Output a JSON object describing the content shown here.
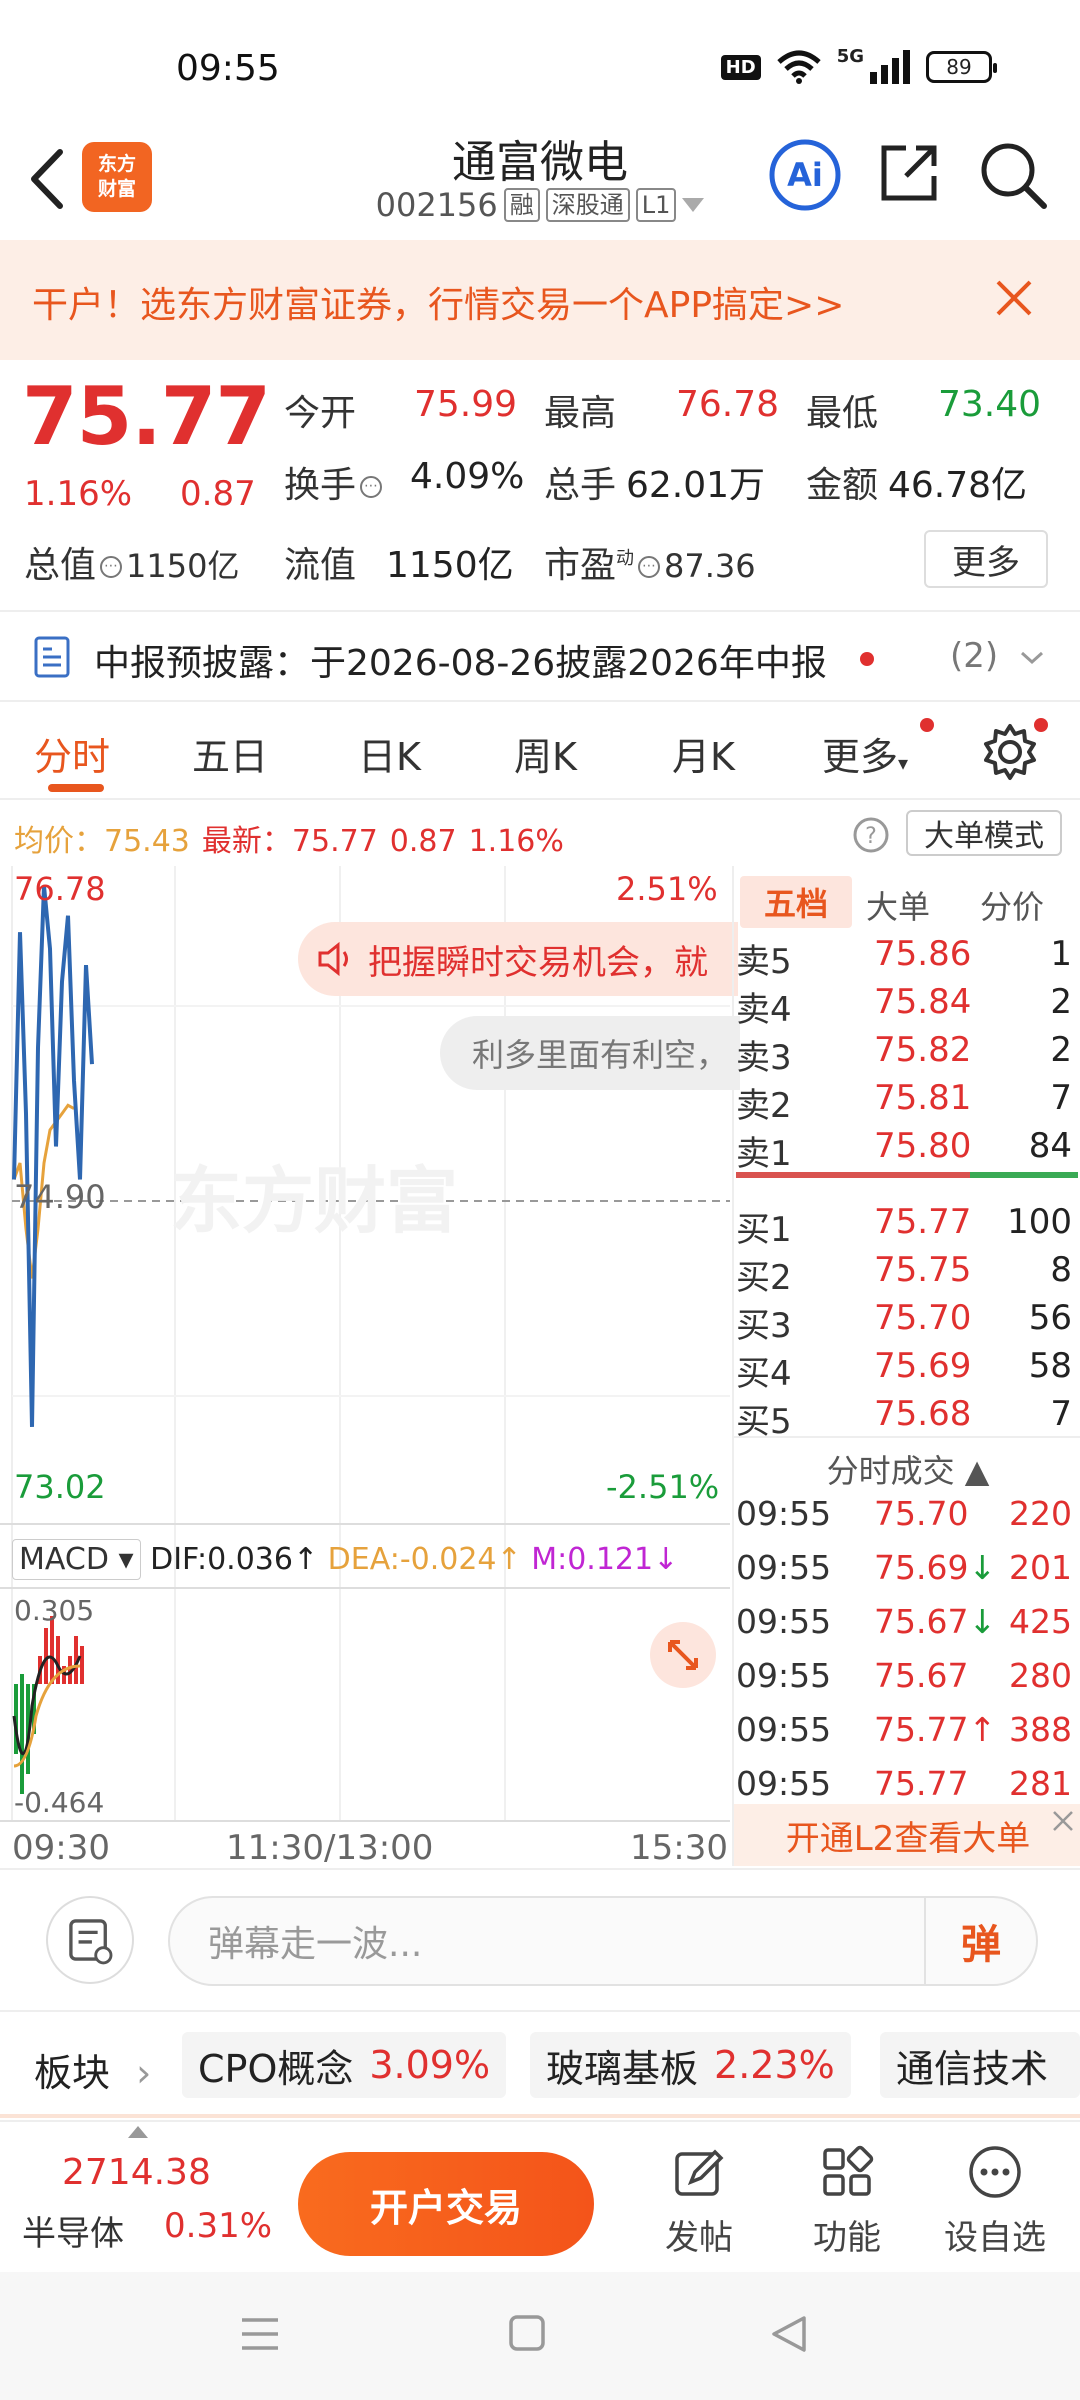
{
  "status_bar": {
    "time": "09:55",
    "network": "5G",
    "hd": "HD",
    "battery": "89"
  },
  "header": {
    "logo_line1": "东方",
    "logo_line2": "财富",
    "stock_name": "通富微电",
    "stock_code": "002156",
    "tag_margin": "融",
    "tag_connect": "深股通",
    "tag_level": "L1",
    "ai_label": "Ai"
  },
  "promo": {
    "text": "干户！选东方财富证券，行情交易一个APP搞定>>"
  },
  "quote": {
    "last_price": "75.77",
    "change_pct": "1.16%",
    "change_amt": "0.87",
    "open_label": "今开",
    "open_value": "75.99",
    "high_label": "最高",
    "high_value": "76.78",
    "low_label": "最低",
    "low_value": "73.40",
    "turnover_label": "换手",
    "turnover_value": "4.09%",
    "volume_label": "总手",
    "volume_value": "62.01万",
    "amount_label": "金额",
    "amount_value": "46.78亿",
    "mktcap_label": "总值",
    "mktcap_value": "1150亿",
    "float_label": "流值",
    "float_value": "1150亿",
    "pe_label": "市盈",
    "pe_sup": "动",
    "pe_value": "87.36",
    "more_label": "更多"
  },
  "notice": {
    "text": "中报预披露：于2026-08-26披露2026年中报",
    "count": "(2)"
  },
  "period_tabs": [
    "分时",
    "五日",
    "日K",
    "周K",
    "月K",
    "更多"
  ],
  "avg_row": {
    "avg_label": "均价：",
    "avg_value": "75.43",
    "latest_label": "最新：",
    "latest_value": "75.77",
    "latest_change": "0.87",
    "latest_pct": "1.16%",
    "mode_btn": "大单模式"
  },
  "chart": {
    "y_top": "76.78",
    "y_top_pct": "2.51%",
    "y_mid": "74.90",
    "y_bottom": "73.02",
    "y_bottom_pct": "-2.51%",
    "watermark": "东方财富",
    "tip_text": "把握瞬时交易机会，就",
    "tip2_text": "利多里面有利空，",
    "macd_select": "MACD",
    "dif": "DIF:0.036",
    "dea": "DEA:-0.024",
    "m": "M:0.121",
    "macd_top": "0.305",
    "macd_bottom": "-0.464",
    "time_start": "09:30",
    "time_mid": "11:30/13:00",
    "time_end": "15:30",
    "price_line": [
      75.0,
      76.5,
      75.4,
      73.5,
      75.8,
      76.78,
      76.4,
      75.2,
      76.2,
      76.6,
      75.6,
      75.0,
      76.3,
      75.7
    ],
    "avg_line": [
      75.0,
      75.1,
      74.7,
      74.4,
      74.7,
      75.1,
      75.3,
      75.35,
      75.4,
      75.45,
      75.43
    ]
  },
  "order_book": {
    "tabs": [
      "五档",
      "大单",
      "分价"
    ],
    "asks": [
      {
        "label": "卖5",
        "price": "75.86",
        "vol": "1"
      },
      {
        "label": "卖4",
        "price": "75.84",
        "vol": "2"
      },
      {
        "label": "卖3",
        "price": "75.82",
        "vol": "2"
      },
      {
        "label": "卖2",
        "price": "75.81",
        "vol": "7"
      },
      {
        "label": "卖1",
        "price": "75.80",
        "vol": "84"
      }
    ],
    "bids": [
      {
        "label": "买1",
        "price": "75.77",
        "vol": "100"
      },
      {
        "label": "买2",
        "price": "75.75",
        "vol": "8"
      },
      {
        "label": "买3",
        "price": "75.70",
        "vol": "56"
      },
      {
        "label": "买4",
        "price": "75.69",
        "vol": "58"
      },
      {
        "label": "买5",
        "price": "75.68",
        "vol": "7"
      }
    ],
    "ticks_title": "分时成交",
    "ticks": [
      {
        "time": "09:55",
        "price": "75.70",
        "arrow": "",
        "vol": "220"
      },
      {
        "time": "09:55",
        "price": "75.69",
        "arrow": "↓",
        "vol": "201"
      },
      {
        "time": "09:55",
        "price": "75.67",
        "arrow": "↓",
        "vol": "425"
      },
      {
        "time": "09:55",
        "price": "75.67",
        "arrow": "",
        "vol": "280"
      },
      {
        "time": "09:55",
        "price": "75.77",
        "arrow": "↑",
        "vol": "388"
      },
      {
        "time": "09:55",
        "price": "75.77",
        "arrow": "",
        "vol": "281"
      }
    ],
    "l2_btn": "开通L2查看大单"
  },
  "comment_bar": {
    "placeholder": "弹幕走一波...",
    "send_label": "弹"
  },
  "sectors": {
    "label": "板块",
    "chips": [
      {
        "name": "CPO概念",
        "pct": "3.09%"
      },
      {
        "name": "玻璃基板",
        "pct": "2.23%"
      },
      {
        "name": "通信技术",
        "pct": ""
      }
    ]
  },
  "bottom_toolbar": {
    "index_value": "2714.38",
    "index_name": "半导体",
    "index_pct": "0.31%",
    "open_account": "开户交易",
    "post": "发帖",
    "function": "功能",
    "watchlist": "设自选"
  },
  "colors": {
    "up": "#e0302f",
    "down": "#1a9c3a",
    "accent": "#e8561e",
    "price_line": "#2e67b1",
    "avg_line": "#e6a23c"
  }
}
